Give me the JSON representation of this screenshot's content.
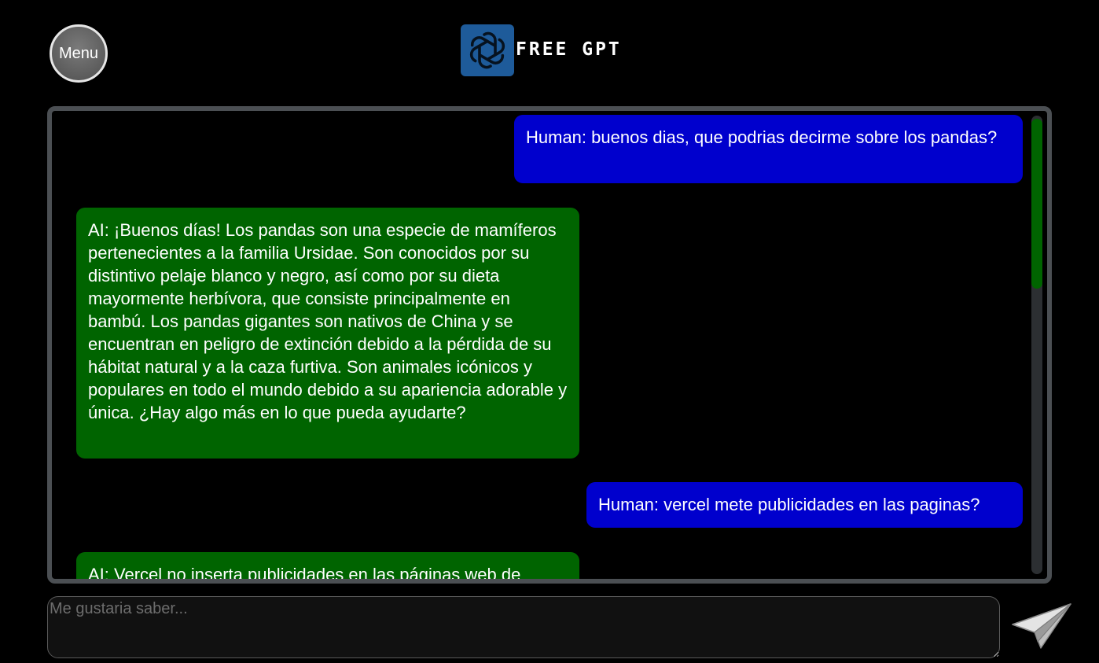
{
  "header": {
    "menu_label": "Menu",
    "title": "FREE GPT",
    "logo_icon": "openai-logo-icon",
    "logo_bg_color": "#1e5b9a"
  },
  "chat": {
    "messages": [
      {
        "role": "human",
        "text": "Human: buenos dias, que podrias decirme sobre los pandas?"
      },
      {
        "role": "ai",
        "text": "AI: ¡Buenos días! Los pandas son una especie de mamíferos pertenecientes a la familia Ursidae. Son conocidos por su distintivo pelaje blanco y negro, así como por su dieta mayormente herbívora, que consiste principalmente en bambú. Los pandas gigantes son nativos de China y se encuentran en peligro de extinción debido a la pérdida de su hábitat natural y a la caza furtiva. Son animales icónicos y populares en todo el mundo debido a su apariencia adorable y única. ¿Hay algo más en lo que pueda ayudarte?"
      },
      {
        "role": "human",
        "text": "Human: vercel mete publicidades en las paginas?"
      },
      {
        "role": "ai",
        "text": "AI: Vercel no inserta publicidades en las páginas web de"
      }
    ],
    "colors": {
      "human_bubble": "#0000cd",
      "ai_bubble": "#006400",
      "panel_border": "#4b4f53",
      "scrollbar_thumb": "#006400"
    }
  },
  "composer": {
    "placeholder": "Me gustaria saber...",
    "value": "",
    "send_icon": "paper-plane-icon"
  }
}
